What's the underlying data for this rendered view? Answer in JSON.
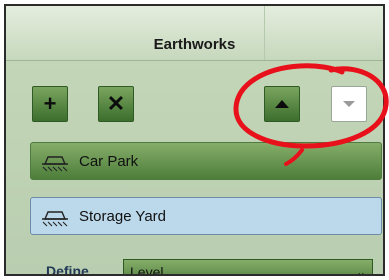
{
  "panel": {
    "title": "Earthworks"
  },
  "toolbar": {
    "add_symbol": "+",
    "delete_symbol": "✕",
    "move_up_icon": "triangle-up-icon",
    "dropdown_icon": "triangle-down-icon"
  },
  "list": {
    "items": [
      {
        "label": "Car Park",
        "icon": "earthwork-icon",
        "selected": false
      },
      {
        "label": "Storage Yard",
        "icon": "earthwork-icon",
        "selected": true
      }
    ]
  },
  "define": {
    "label": "Define",
    "value": "Level"
  },
  "annotation": {
    "color": "#e8101a",
    "shape": "hand-drawn-circle"
  }
}
